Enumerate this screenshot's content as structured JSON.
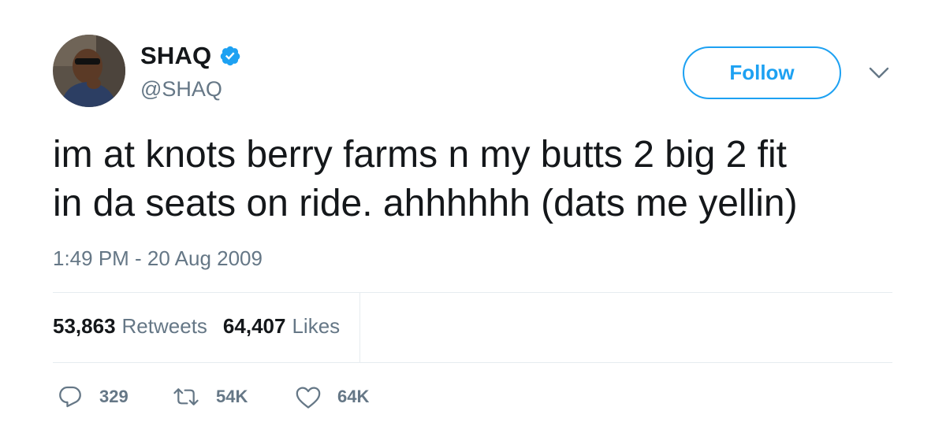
{
  "user": {
    "display_name": "SHAQ",
    "handle": "@SHAQ",
    "verified": true,
    "avatar_icon": "profile-photo"
  },
  "header": {
    "follow_label": "Follow",
    "menu_icon": "chevron-down-icon"
  },
  "tweet": {
    "text_line1": "im at knots berry farms n my butts 2 big 2 fit",
    "text_line2": "in da seats on ride. ahhhhhh (dats me yellin)",
    "timestamp": "1:49 PM - 20 Aug 2009"
  },
  "stats": {
    "retweets_count": "53,863",
    "retweets_label": "Retweets",
    "likes_count": "64,407",
    "likes_label": "Likes"
  },
  "actions": {
    "reply_count": "329",
    "retweet_count": "54K",
    "like_count": "64K"
  },
  "colors": {
    "accent": "#1da1f2",
    "muted": "#657786",
    "text": "#14171a",
    "divider": "#e6ecf0"
  }
}
